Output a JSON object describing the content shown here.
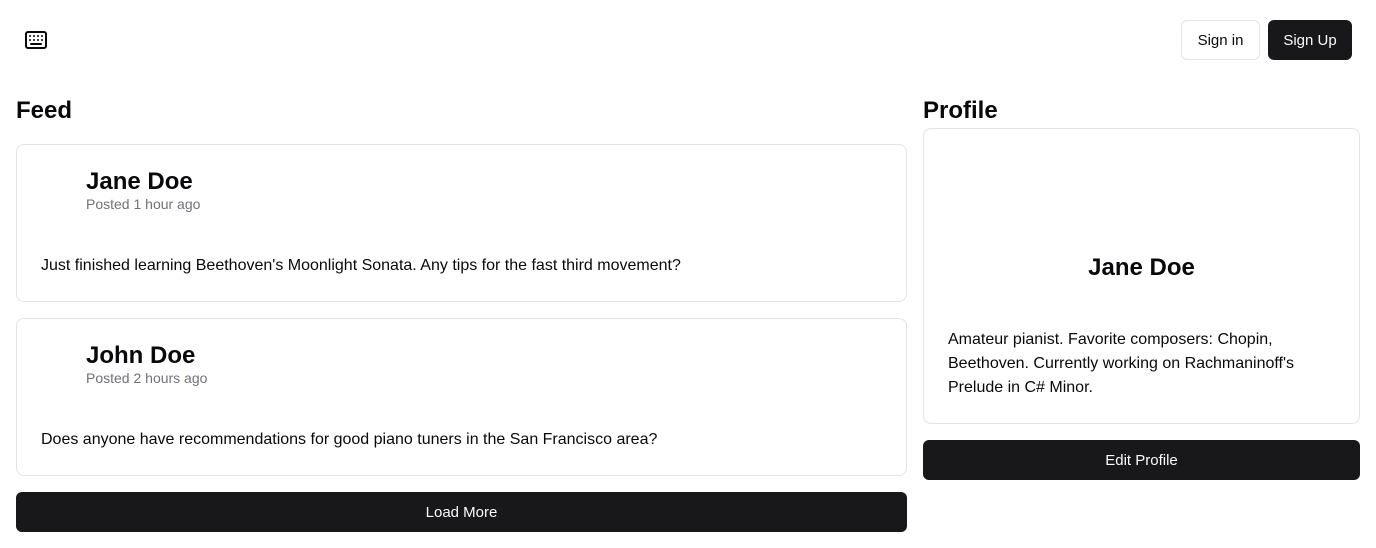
{
  "header": {
    "logo_icon": "keyboard-icon",
    "sign_in_label": "Sign in",
    "sign_up_label": "Sign Up"
  },
  "feed": {
    "title": "Feed",
    "posts": [
      {
        "author": "Jane Doe",
        "time": "Posted 1 hour ago",
        "body": "Just finished learning Beethoven's Moonlight Sonata. Any tips for the fast third movement?"
      },
      {
        "author": "John Doe",
        "time": "Posted 2 hours ago",
        "body": "Does anyone have recommendations for good piano tuners in the San Francisco area?"
      }
    ],
    "load_more_label": "Load More"
  },
  "profile": {
    "title": "Profile",
    "name": "Jane Doe",
    "bio": "Amateur pianist. Favorite composers: Chopin, Beethoven. Currently working on Rachmaninoff's Prelude in C# Minor.",
    "edit_label": "Edit Profile"
  },
  "colors": {
    "primary": "#18181b",
    "muted_text": "#71717a",
    "border": "#e4e4e7"
  }
}
